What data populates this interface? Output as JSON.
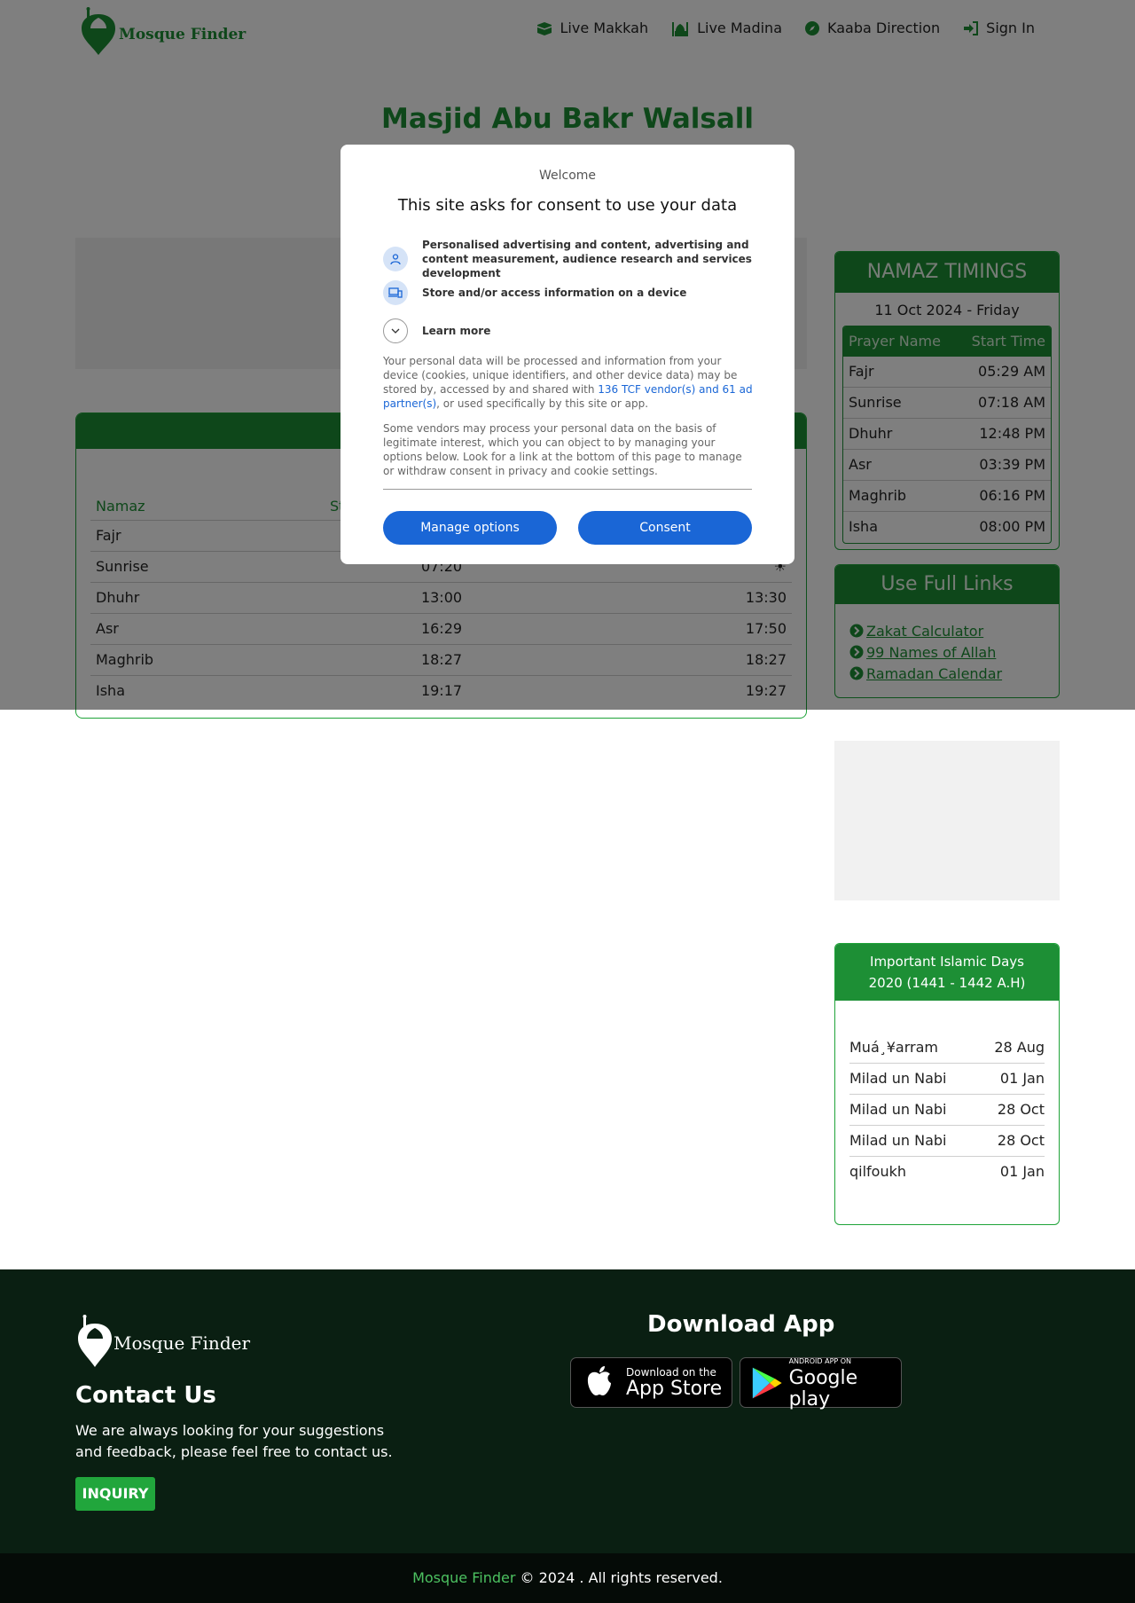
{
  "nav": {
    "logo_text": "Mosque Finder",
    "links": [
      {
        "label": "Live Makkah",
        "icon": "kaaba-icon"
      },
      {
        "label": "Live Madina",
        "icon": "mosque-icon"
      },
      {
        "label": "Kaaba Direction",
        "icon": "compass-icon"
      },
      {
        "label": "Sign In",
        "icon": "sign-in-icon"
      }
    ]
  },
  "hero": {
    "title": "Masjid Abu Bakr Walsall"
  },
  "main_table": {
    "headers": [
      "Namaz",
      "St",
      ""
    ],
    "rows": [
      {
        "name": "Fajr",
        "start": "",
        "jamaat": ""
      },
      {
        "name": "Sunrise",
        "start": "07:20",
        "jamaat": "☀"
      },
      {
        "name": "Dhuhr",
        "start": "13:00",
        "jamaat": "13:30"
      },
      {
        "name": "Asr",
        "start": "16:29",
        "jamaat": "17:50"
      },
      {
        "name": "Maghrib",
        "start": "18:27",
        "jamaat": "18:27"
      },
      {
        "name": "Isha",
        "start": "19:17",
        "jamaat": "19:27"
      }
    ]
  },
  "namaz_timings": {
    "title": "NAMAZ TIMINGS",
    "date": "11 Oct 2024 - Friday",
    "col1": "Prayer Name",
    "col2": "Start Time",
    "rows": [
      {
        "name": "Fajr",
        "time": "05:29 AM"
      },
      {
        "name": "Sunrise",
        "time": "07:18 AM"
      },
      {
        "name": "Dhuhr",
        "time": "12:48 PM"
      },
      {
        "name": "Asr",
        "time": "03:39 PM"
      },
      {
        "name": "Maghrib",
        "time": "06:16 PM"
      },
      {
        "name": "Isha",
        "time": "08:00 PM"
      }
    ]
  },
  "useful_links": {
    "title": "Use Full Links",
    "items": [
      "Zakat Calculator",
      "99 Names of Allah",
      "Ramadan Calendar"
    ]
  },
  "islamic_days": {
    "title_line1": "Important Islamic Days",
    "title_line2": "2020 (1441 - 1442 A.H)",
    "rows": [
      {
        "name": "Muá¸¥arram",
        "date": "28 Aug"
      },
      {
        "name": "Milad un Nabi",
        "date": "01 Jan"
      },
      {
        "name": "Milad un Nabi",
        "date": "28 Oct"
      },
      {
        "name": "Milad un Nabi",
        "date": "28 Oct"
      },
      {
        "name": "qilfoukh",
        "date": "01 Jan"
      }
    ]
  },
  "footer": {
    "logo_text": "Mosque Finder",
    "contact_title": "Contact Us",
    "contact_text": "We are always looking for your suggestions and feedback, please feel free to contact us.",
    "inquiry": "INQUIRY",
    "download_title": "Download App",
    "appstore_small": "Download on the",
    "appstore_big": "App Store",
    "gplay_small": "ANDROID APP ON",
    "gplay_big": "Google play",
    "copyright_brand": "Mosque Finder",
    "copyright_rest": " © 2024 . All rights reserved."
  },
  "consent": {
    "welcome": "Welcome",
    "title": "This site asks for consent to use your data",
    "purpose1": "Personalised advertising and content, advertising and content measurement, audience research and services development",
    "purpose2": "Store and/or access information on a device",
    "learn_more": "Learn more",
    "para1_a": "Your personal data will be processed and information from your device (cookies, unique identifiers, and other device data) may be stored by, accessed by and shared with ",
    "para1_link": "136 TCF vendor(s) and 61 ad partner(s)",
    "para1_b": ", or used specifically by this site or app.",
    "para2": "Some vendors may process your personal data on the basis of legitimate interest, which you can object to by managing your options below. Look for a link at the bottom of this page to manage or withdraw consent in privacy and cookie settings.",
    "manage": "Manage options",
    "consent_btn": "Consent"
  },
  "colors": {
    "brand_green": "#1d8f35",
    "consent_blue": "#1a66d6",
    "footer_bg": "#0a1f12"
  }
}
